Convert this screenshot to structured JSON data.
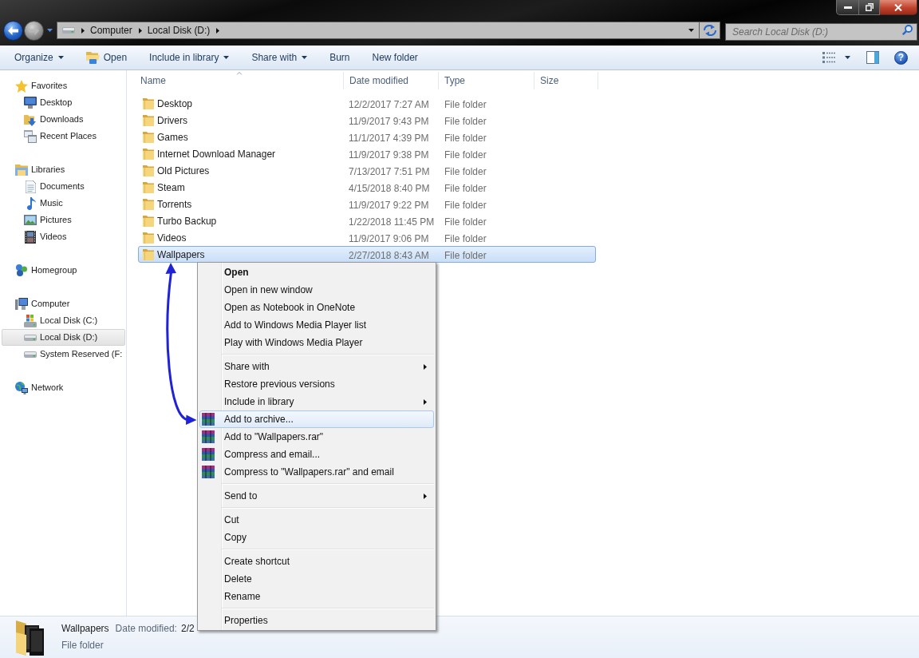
{
  "nav": {
    "back": {
      "disabled": false
    },
    "forward": {
      "disabled": true
    }
  },
  "address_bar": {
    "breadcrumbs": [
      "Computer",
      "Local Disk (D:)"
    ]
  },
  "search": {
    "placeholder": "Search Local Disk (D:)"
  },
  "toolbar": {
    "items": [
      {
        "label": "Organize",
        "kind": "dropdown"
      },
      {
        "label": "Open",
        "kind": "icon"
      },
      {
        "label": "Include in library",
        "kind": "dropdown"
      },
      {
        "label": "Share with",
        "kind": "dropdown"
      },
      {
        "label": "Burn",
        "kind": "plain"
      },
      {
        "label": "New folder",
        "kind": "plain"
      }
    ],
    "help": "?"
  },
  "sidebar": {
    "groups": [
      {
        "label": "Favorites",
        "selected": false,
        "children": [
          {
            "label": "Desktop",
            "selected": false
          },
          {
            "label": "Downloads",
            "selected": false
          },
          {
            "label": "Recent Places",
            "selected": false
          }
        ]
      },
      {
        "label": "Libraries",
        "selected": false,
        "children": [
          {
            "label": "Documents",
            "selected": false
          },
          {
            "label": "Music",
            "selected": false
          },
          {
            "label": "Pictures",
            "selected": false
          },
          {
            "label": "Videos",
            "selected": false
          }
        ]
      },
      {
        "label": "Homegroup",
        "selected": false
      },
      {
        "label": "Computer",
        "selected": false,
        "children": [
          {
            "label": "Local Disk (C:)",
            "selected": false
          },
          {
            "label": "Local Disk (D:)",
            "selected": true
          },
          {
            "label": "System Reserved (F:",
            "selected": false
          }
        ]
      },
      {
        "label": "Network",
        "selected": false
      }
    ]
  },
  "file_list": {
    "columns": [
      {
        "label": "Name",
        "sorted": true
      },
      {
        "label": "Date modified",
        "sorted": false
      },
      {
        "label": "Type",
        "sorted": false
      },
      {
        "label": "Size",
        "sorted": false
      }
    ],
    "rows": [
      {
        "name": "Desktop",
        "date_modified": "12/2/2017 7:27 AM",
        "type": "File folder",
        "selected": false
      },
      {
        "name": "Drivers",
        "date_modified": "11/9/2017 9:43 PM",
        "type": "File folder",
        "selected": false
      },
      {
        "name": "Games",
        "date_modified": "11/1/2017 4:39 PM",
        "type": "File folder",
        "selected": false
      },
      {
        "name": "Internet Download Manager",
        "date_modified": "11/9/2017 9:38 PM",
        "type": "File folder",
        "selected": false
      },
      {
        "name": "Old Pictures",
        "date_modified": "7/13/2017 7:51 PM",
        "type": "File folder",
        "selected": false
      },
      {
        "name": "Steam",
        "date_modified": "4/15/2018 8:40 PM",
        "type": "File folder",
        "selected": false
      },
      {
        "name": "Torrents",
        "date_modified": "11/9/2017 9:22 PM",
        "type": "File folder",
        "selected": false
      },
      {
        "name": "Turbo Backup",
        "date_modified": "1/22/2018 11:45 PM",
        "type": "File folder",
        "selected": false
      },
      {
        "name": "Videos",
        "date_modified": "11/9/2017 9:06 PM",
        "type": "File folder",
        "selected": false
      },
      {
        "name": "Wallpapers",
        "date_modified": "2/27/2018 8:43 AM",
        "type": "File folder",
        "selected": true
      }
    ]
  },
  "context_menu": {
    "sections": [
      {
        "items": [
          {
            "label": "Open",
            "kind": "plain",
            "default": true,
            "submenu": false,
            "selected": false
          },
          {
            "label": "Open in new window",
            "kind": "plain",
            "default": false,
            "submenu": false,
            "selected": false
          },
          {
            "label": "Open as Notebook in OneNote",
            "kind": "plain",
            "default": false,
            "submenu": false,
            "selected": false
          },
          {
            "label": "Add to Windows Media Player list",
            "kind": "plain",
            "default": false,
            "submenu": false,
            "selected": false
          },
          {
            "label": "Play with Windows Media Player",
            "kind": "plain",
            "default": false,
            "submenu": false,
            "selected": false
          }
        ]
      },
      {
        "items": [
          {
            "label": "Share with",
            "kind": "plain",
            "default": false,
            "submenu": true,
            "selected": false
          },
          {
            "label": "Restore previous versions",
            "kind": "plain",
            "default": false,
            "submenu": false,
            "selected": false
          },
          {
            "label": "Include in library",
            "kind": "plain",
            "default": false,
            "submenu": true,
            "selected": false
          },
          {
            "label": "Add to archive...",
            "kind": "archive",
            "default": false,
            "submenu": false,
            "selected": true
          },
          {
            "label": "Add to \"Wallpapers.rar\"",
            "kind": "archive",
            "default": false,
            "submenu": false,
            "selected": false
          },
          {
            "label": "Compress and email...",
            "kind": "archive",
            "default": false,
            "submenu": false,
            "selected": false
          },
          {
            "label": "Compress to \"Wallpapers.rar\" and email",
            "kind": "archive",
            "default": false,
            "submenu": false,
            "selected": false
          }
        ]
      },
      {
        "items": [
          {
            "label": "Send to",
            "kind": "plain",
            "default": false,
            "submenu": true,
            "selected": false
          }
        ]
      },
      {
        "items": [
          {
            "label": "Cut",
            "kind": "plain",
            "default": false,
            "submenu": false,
            "selected": false
          },
          {
            "label": "Copy",
            "kind": "plain",
            "default": false,
            "submenu": false,
            "selected": false
          }
        ]
      },
      {
        "items": [
          {
            "label": "Create shortcut",
            "kind": "plain",
            "default": false,
            "submenu": false,
            "selected": false
          },
          {
            "label": "Delete",
            "kind": "plain",
            "default": false,
            "submenu": false,
            "selected": false
          },
          {
            "label": "Rename",
            "kind": "plain",
            "default": false,
            "submenu": false,
            "selected": false
          }
        ]
      },
      {
        "items": [
          {
            "label": "Properties",
            "kind": "plain",
            "default": false,
            "submenu": false,
            "selected": false
          }
        ]
      }
    ]
  },
  "details_pane": {
    "name": "Wallpapers",
    "date_label": "Date modified:",
    "date_value": "2/2",
    "type": "File folder"
  }
}
